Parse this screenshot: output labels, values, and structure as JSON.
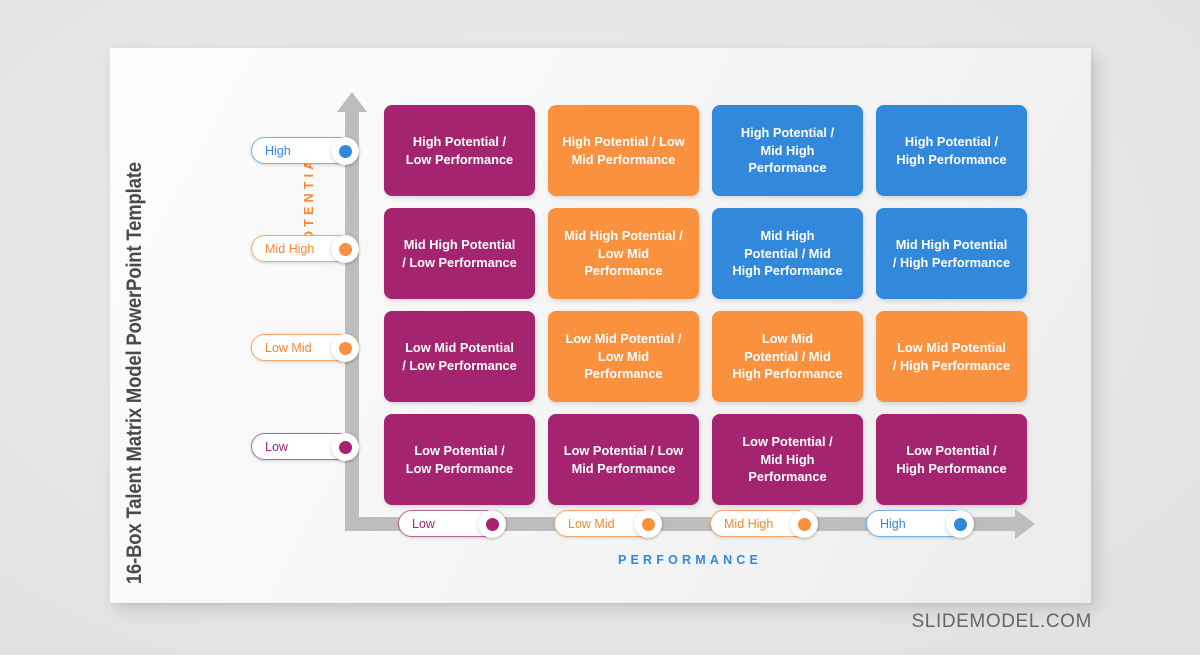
{
  "slide": {
    "side_title": "16-Box Talent Matrix Model PowerPoint Template",
    "watermark": "SLIDEMODEL.COM"
  },
  "axes": {
    "y_label": "POTENTIAL",
    "x_label": "PERFORMANCE",
    "y_axis_color": "#BDBDBD",
    "x_axis_color": "#BDBDBD",
    "y_label_color": "#F58634",
    "x_label_color": "#3289DC"
  },
  "y_pills": [
    {
      "label": "High",
      "color": "#3289DC",
      "theme": "blue"
    },
    {
      "label": "Mid High",
      "color": "#F9913E",
      "theme": "orange"
    },
    {
      "label": "Low Mid",
      "color": "#F9913E",
      "theme": "orange"
    },
    {
      "label": "Low",
      "color": "#A4246F",
      "theme": "magenta"
    }
  ],
  "x_pills": [
    {
      "label": "Low",
      "color": "#A4246F",
      "theme": "magenta"
    },
    {
      "label": "Low Mid",
      "color": "#F9913E",
      "theme": "orange"
    },
    {
      "label": "Mid High",
      "color": "#F9913E",
      "theme": "orange"
    },
    {
      "label": "High",
      "color": "#3289DC",
      "theme": "blue"
    }
  ],
  "palette": {
    "magenta": "#A4246F",
    "orange": "#F9913E",
    "blue": "#3289DC"
  },
  "chart_data": {
    "type": "heatmap",
    "title": "16-Box Talent Matrix Model PowerPoint Template",
    "xlabel": "PERFORMANCE",
    "ylabel": "POTENTIAL",
    "x_categories": [
      "Low",
      "Low Mid",
      "Mid High",
      "High"
    ],
    "y_categories": [
      "High",
      "Mid High",
      "Low Mid",
      "Low"
    ],
    "grid": false,
    "legend": "none",
    "color_categories": {
      "magenta": "#A4246F",
      "orange": "#F9913E",
      "blue": "#3289DC"
    },
    "cells": [
      {
        "row": 0,
        "col": 0,
        "label": "High Potential /\nLow Performance",
        "color": "magenta"
      },
      {
        "row": 0,
        "col": 1,
        "label": "High Potential / Low\nMid Performance",
        "color": "orange"
      },
      {
        "row": 0,
        "col": 2,
        "label": "High Potential /\nMid High\nPerformance",
        "color": "blue"
      },
      {
        "row": 0,
        "col": 3,
        "label": "High Potential /\nHigh Performance",
        "color": "blue"
      },
      {
        "row": 1,
        "col": 0,
        "label": "Mid High Potential\n/ Low Performance",
        "color": "magenta"
      },
      {
        "row": 1,
        "col": 1,
        "label": "Mid High Potential /\nLow Mid\nPerformance",
        "color": "orange"
      },
      {
        "row": 1,
        "col": 2,
        "label": "Mid High\nPotential / Mid\nHigh Performance",
        "color": "blue"
      },
      {
        "row": 1,
        "col": 3,
        "label": "Mid High Potential\n/ High Performance",
        "color": "blue"
      },
      {
        "row": 2,
        "col": 0,
        "label": "Low Mid Potential\n/ Low Performance",
        "color": "magenta"
      },
      {
        "row": 2,
        "col": 1,
        "label": "Low Mid Potential /\nLow Mid\nPerformance",
        "color": "orange"
      },
      {
        "row": 2,
        "col": 2,
        "label": "Low Mid\nPotential / Mid\nHigh Performance",
        "color": "orange"
      },
      {
        "row": 2,
        "col": 3,
        "label": "Low Mid Potential\n/ High Performance",
        "color": "orange"
      },
      {
        "row": 3,
        "col": 0,
        "label": "Low Potential /\nLow Performance",
        "color": "magenta"
      },
      {
        "row": 3,
        "col": 1,
        "label": "Low Potential / Low\nMid Performance",
        "color": "magenta"
      },
      {
        "row": 3,
        "col": 2,
        "label": "Low Potential /\nMid High\nPerformance",
        "color": "magenta"
      },
      {
        "row": 3,
        "col": 3,
        "label": "Low Potential /\nHigh Performance",
        "color": "magenta"
      }
    ]
  }
}
